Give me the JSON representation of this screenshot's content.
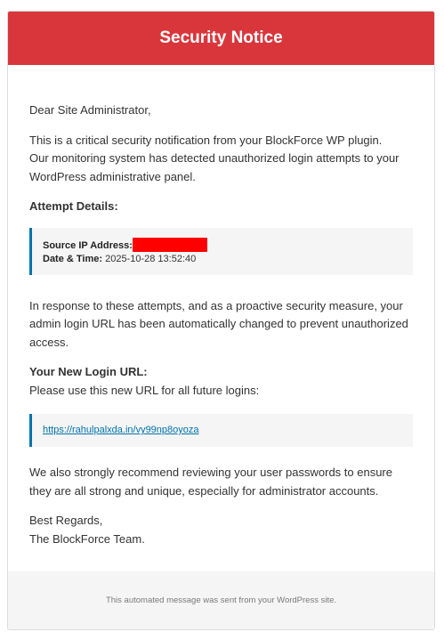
{
  "header": {
    "title": "Security Notice"
  },
  "body": {
    "greeting": "Dear Site Administrator,",
    "intro_line1": "This is a critical security notification from your BlockForce WP plugin.",
    "intro_line2": "Our monitoring system has detected unauthorized login attempts to your WordPress administrative panel.",
    "attempt_title": "Attempt Details:",
    "attempt": {
      "ip_label": "Source IP Address:",
      "datetime_label": "Date & Time:",
      "datetime_value": " 2025-10-28 13:52:40"
    },
    "response_text": "In response to these attempts, and as a proactive security measure, your admin login URL has been automatically changed to prevent unauthorized access.",
    "new_url_title": "Your New Login URL:",
    "new_url_instruction": "Please use this new URL for all future logins:",
    "new_url": "https://rahulpalxda.in/vy99np8oyoza",
    "recommend_text": "We also strongly recommend reviewing your user passwords to ensure they are all strong and unique, especially for administrator accounts.",
    "signoff": "Best Regards,",
    "team": "The BlockForce Team."
  },
  "footer": {
    "text": "This automated message was sent from your WordPress site."
  },
  "colors": {
    "header_bg": "#d9363c",
    "accent": "#0073aa",
    "redaction": "#ff0000"
  }
}
